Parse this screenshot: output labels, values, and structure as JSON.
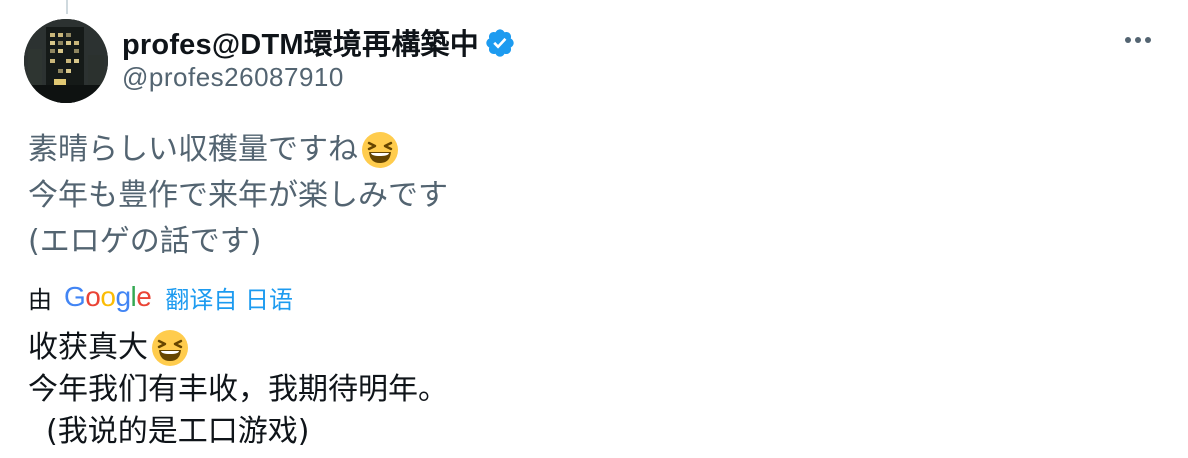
{
  "author": {
    "display_name": "profes@DTM環境再構築中",
    "handle": "@profes26087910",
    "verified": true
  },
  "tweet": {
    "original_lines": [
      "素晴らしい収穫量ですね",
      "今年も豊作で来年が楽しみです",
      "(エロゲの話です)"
    ],
    "translation": {
      "prefix": "由",
      "provider": "Google",
      "link_text": "翻译自 日语",
      "lines": [
        "收获真大",
        "今年我们有丰收，我期待明年。",
        "(我说的是工口游戏)"
      ]
    }
  },
  "icons": {
    "verified": "verified-badge-icon",
    "more": "more-options-icon",
    "emoji": "grinning-squinting-face-emoji"
  },
  "colors": {
    "text_primary": "#0f1419",
    "text_secondary": "#536471",
    "link_blue": "#1d9bf0",
    "google_blue": "#4285f4",
    "google_red": "#ea4335",
    "google_yellow": "#fbbc05",
    "google_green": "#34a853"
  }
}
